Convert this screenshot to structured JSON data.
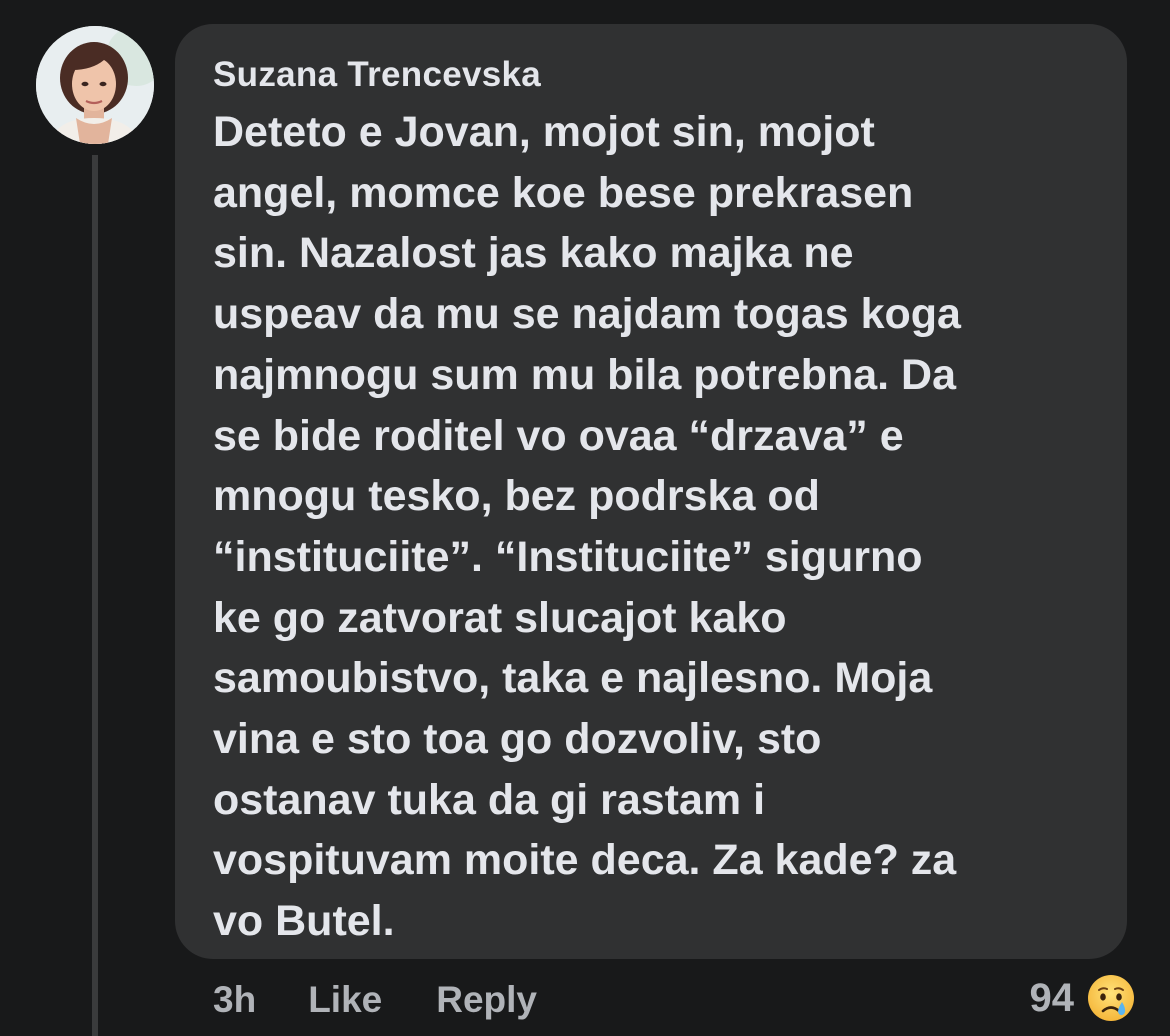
{
  "comment": {
    "author": "Suzana Trencevska",
    "text_lines": [
      "Deteto e Jovan, mojot sin, mojot",
      "angel, momce koe bese prekrasen",
      "sin. Nazalost jas kako majka ne",
      "uspeav da mu se najdam togas koga",
      "najmnogu sum mu bila potrebna. Da",
      "se bide roditel vo ovaa “drzava” e",
      "mnogu tesko, bez podrska od",
      "“instituciite”. “Instituciite” sigurno",
      "ke go zatvorat slucajot kako",
      "samoubistvo, taka e najlesno. Moja",
      "vina e sto toa go dozvoliv, sto",
      "ostanav tuka da gi rastam i",
      "vospituvam moite deca. Za kade? za",
      "vo Butel."
    ]
  },
  "actions": {
    "time": "3h",
    "like_label": "Like",
    "reply_label": "Reply"
  },
  "reactions": {
    "count": "94",
    "icon": "sad-tear-emoji-icon"
  },
  "colors": {
    "background": "#18191a",
    "bubble": "#303132",
    "text": "#e4e6eb",
    "secondary_text": "#b0b3b8"
  }
}
